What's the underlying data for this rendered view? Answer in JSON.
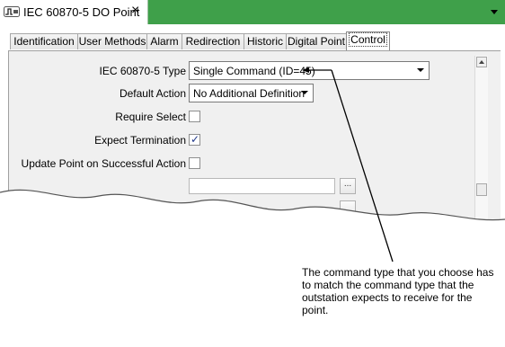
{
  "window": {
    "title": "IEC 60870-5 DO Point",
    "close_glyph": "×",
    "accent_color": "#3fa04a"
  },
  "tabs": [
    {
      "label": "Identification",
      "active": false
    },
    {
      "label": "User Methods",
      "active": false
    },
    {
      "label": "Alarm",
      "active": false
    },
    {
      "label": "Redirection",
      "active": false
    },
    {
      "label": "Historic",
      "active": false
    },
    {
      "label": "Digital Point",
      "active": false
    },
    {
      "label": "Control",
      "active": true
    }
  ],
  "form": {
    "type_label": "IEC 60870-5 Type",
    "type_value": "Single Command (ID=45)",
    "default_action_label": "Default Action",
    "default_action_value": "No Additional Definition",
    "require_select_label": "Require Select",
    "require_select_checked": false,
    "expect_termination_label": "Expect Termination",
    "expect_termination_checked": true,
    "update_point_label": "Update Point on Successful Action",
    "update_point_checked": false,
    "tick_glyph": "✓",
    "ellipsis": "..."
  },
  "callout": {
    "text": "The command type that you choose has to match the command type that the outstation expects to receive for the point."
  }
}
